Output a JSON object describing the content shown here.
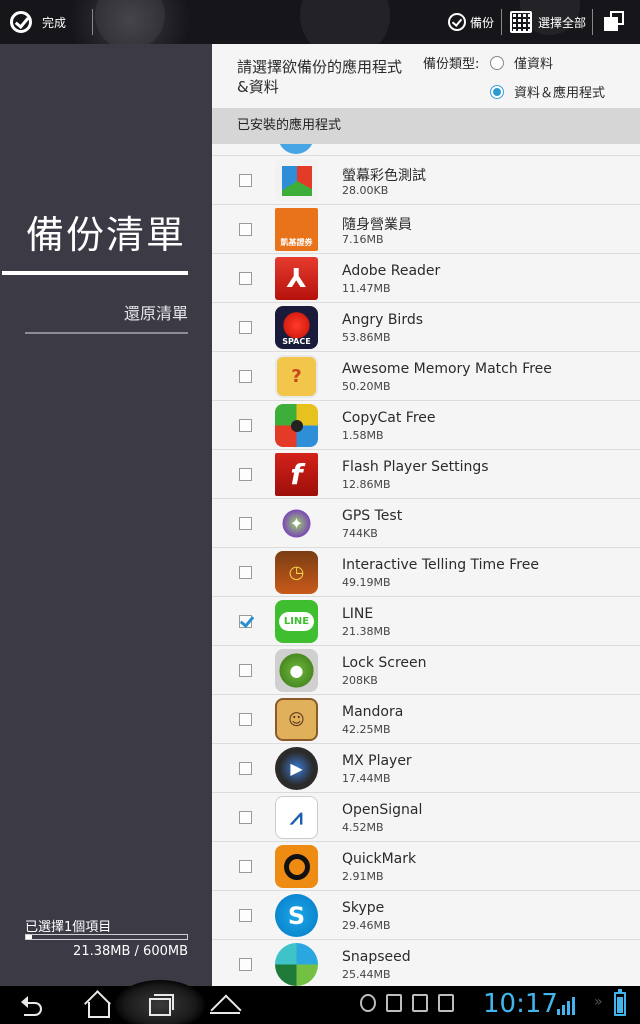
{
  "actionbar": {
    "done_label": "完成",
    "backup_label": "備份",
    "select_all_label": "選擇全部"
  },
  "sidebar": {
    "title": "備份清單",
    "restore_label": "還原清單",
    "selected_count": "已選擇1個項目",
    "storage_text": "21.38MB / 600MB",
    "storage_fraction": 0.0356
  },
  "content": {
    "prompt": "請選擇欲備份的應用程式&資料",
    "backup_type_label": "備份類型:",
    "options": [
      {
        "label": "僅資料",
        "selected": false
      },
      {
        "label": "資料＆應用程式",
        "selected": true
      }
    ],
    "section_header": "已安裝的應用程式"
  },
  "apps": [
    {
      "name": "螢幕彩色測試",
      "size": "28.00KB",
      "checked": false,
      "icon": "color-cubes-icon"
    },
    {
      "name": "隨身營業員",
      "size": "7.16MB",
      "checked": false,
      "icon": "securities-app-icon",
      "icon_text": "凱基證券"
    },
    {
      "name": "Adobe Reader",
      "size": "11.47MB",
      "checked": false,
      "icon": "adobe-reader-icon"
    },
    {
      "name": "Angry Birds",
      "size": "53.86MB",
      "checked": false,
      "icon": "angry-birds-icon",
      "icon_text": "SPACE"
    },
    {
      "name": "Awesome Memory Match Free",
      "size": "50.20MB",
      "checked": false,
      "icon": "memory-match-icon"
    },
    {
      "name": "CopyCat Free",
      "size": "1.58MB",
      "checked": false,
      "icon": "copycat-icon"
    },
    {
      "name": "Flash Player Settings",
      "size": "12.86MB",
      "checked": false,
      "icon": "flash-player-icon"
    },
    {
      "name": "GPS Test",
      "size": "744KB",
      "checked": false,
      "icon": "gps-test-icon"
    },
    {
      "name": "Interactive Telling Time Free",
      "size": "49.19MB",
      "checked": false,
      "icon": "telling-time-icon"
    },
    {
      "name": "LINE",
      "size": "21.38MB",
      "checked": true,
      "icon": "line-icon",
      "icon_text": "LINE"
    },
    {
      "name": "Lock Screen",
      "size": "208KB",
      "checked": false,
      "icon": "lock-screen-icon"
    },
    {
      "name": "Mandora",
      "size": "42.25MB",
      "checked": false,
      "icon": "mandora-icon"
    },
    {
      "name": "MX Player",
      "size": "17.44MB",
      "checked": false,
      "icon": "mx-player-icon"
    },
    {
      "name": "OpenSignal",
      "size": "4.52MB",
      "checked": false,
      "icon": "opensignal-icon"
    },
    {
      "name": "QuickMark",
      "size": "2.91MB",
      "checked": false,
      "icon": "quickmark-icon"
    },
    {
      "name": "Skype",
      "size": "29.46MB",
      "checked": false,
      "icon": "skype-icon"
    },
    {
      "name": "Snapseed",
      "size": "25.44MB",
      "checked": false,
      "icon": "snapseed-icon"
    }
  ],
  "statusbar": {
    "time": "10:17",
    "accent": "#42b6ec"
  }
}
